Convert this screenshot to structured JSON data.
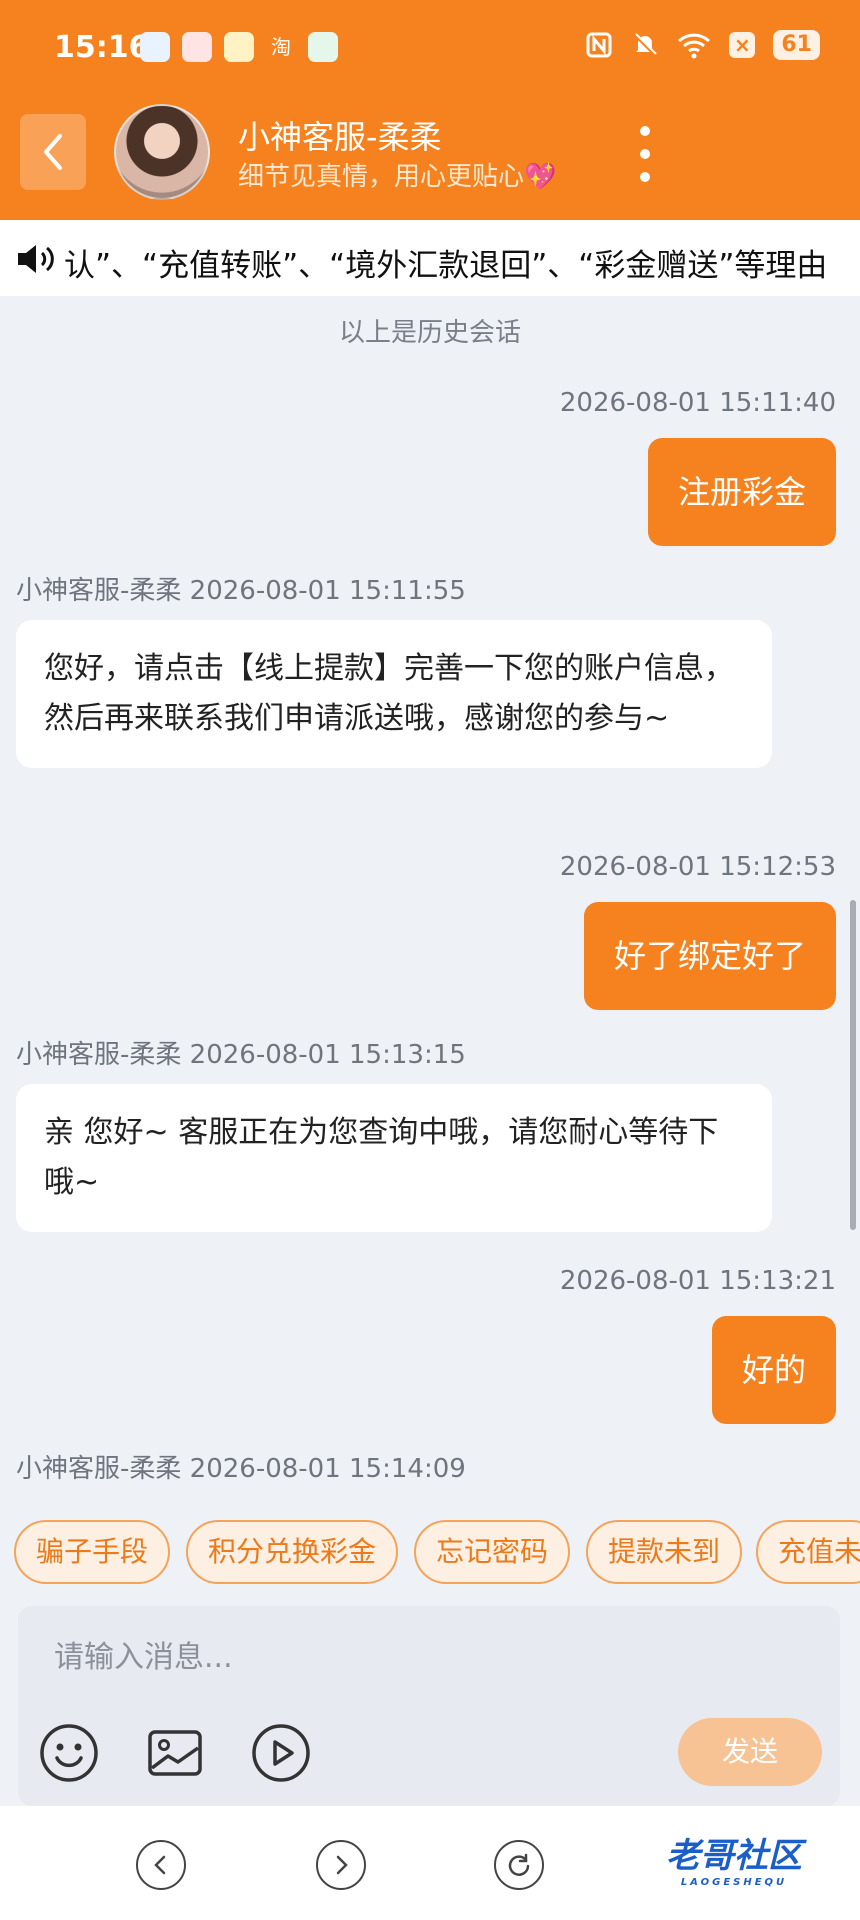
{
  "status_bar": {
    "time": "15:16",
    "app_glyph": "淘",
    "battery": "61",
    "close_badge": "×"
  },
  "header": {
    "agent_name": "小神客服-柔柔",
    "tagline": "细节见真情，用心更贴心",
    "tagline_emoji": "💖"
  },
  "marquee": {
    "text": "认”、“充值转账”、“境外汇款退回”、“彩金赠送”等理由"
  },
  "chat": {
    "history_note": "以上是历史会话",
    "messages": [
      {
        "side": "out",
        "timestamp": "2026-08-01 15:11:40",
        "text": "注册彩金"
      },
      {
        "side": "in",
        "sender": "小神客服-柔柔",
        "timestamp": "2026-08-01 15:11:55",
        "header": "小神客服-柔柔 2026-08-01 15:11:55",
        "text": "您好，请点击【线上提款】完善一下您的账户信息，然后再来联系我们申请派送哦，感谢您的参与~"
      },
      {
        "side": "out",
        "timestamp": "2026-08-01 15:12:53",
        "text": "好了绑定好了"
      },
      {
        "side": "in",
        "sender": "小神客服-柔柔",
        "timestamp": "2026-08-01 15:13:15",
        "header": "小神客服-柔柔 2026-08-01 15:13:15",
        "text": "亲 您好~ 客服正在为您查询中哦，请您耐心等待下哦~"
      },
      {
        "side": "out",
        "timestamp": "2026-08-01 15:13:21",
        "text": "好的"
      },
      {
        "side": "in",
        "sender": "小神客服-柔柔",
        "timestamp": "2026-08-01 15:14:09",
        "header": "小神客服-柔柔 2026-08-01 15:14:09",
        "text": ""
      }
    ]
  },
  "quick_replies": [
    "骗子手段",
    "积分兑换彩金",
    "忘记密码",
    "提款未到",
    "充值未"
  ],
  "composer": {
    "placeholder": "请输入消息...",
    "send_label": "发送"
  },
  "watermark": {
    "title": "老哥社区",
    "subtitle": "LAOGESHEQU"
  },
  "colors": {
    "brand_orange": "#f6821f",
    "send_disabled": "#f8c394",
    "chip_border": "#f3a35a"
  },
  "icons": [
    "back-arrow-icon",
    "more-vertical-icon",
    "speaker-icon",
    "emoji-icon",
    "image-icon",
    "play-icon",
    "nav-back-icon",
    "nav-forward-icon",
    "nav-refresh-icon",
    "nfc-icon",
    "mute-icon",
    "wifi-icon"
  ]
}
